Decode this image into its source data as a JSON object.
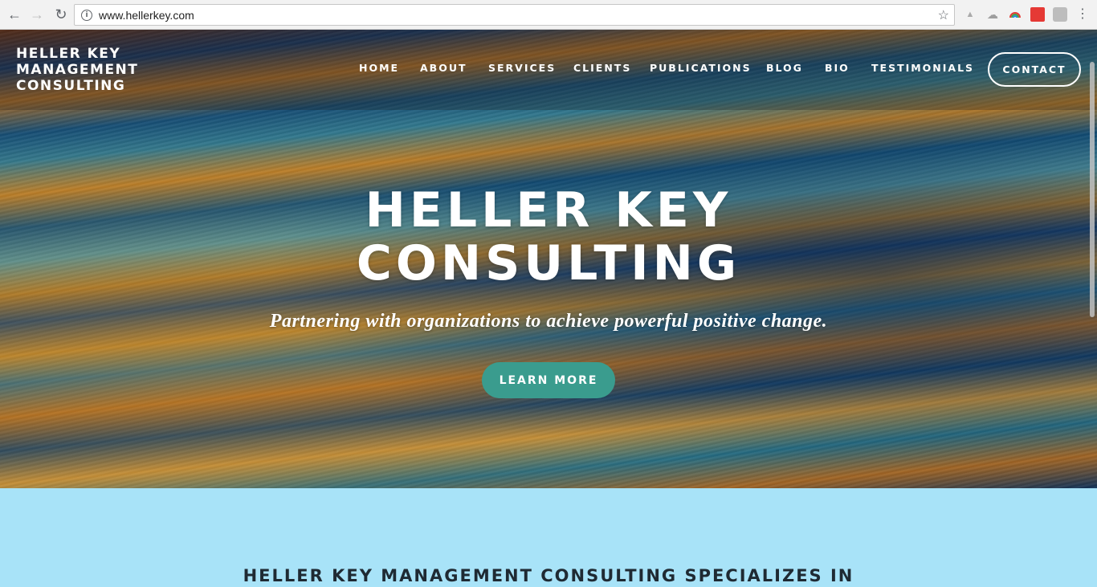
{
  "browser": {
    "url": "www.hellerkey.com",
    "back_glyph": "←",
    "forward_glyph": "→",
    "reload_glyph": "↻",
    "info_glyph": "i",
    "star_glyph": "☆",
    "menu_glyph": "⋮",
    "extensions": [
      {
        "name": "drive-upload-icon",
        "glyph": "▲"
      },
      {
        "name": "cloud-icon",
        "glyph": "☁"
      },
      {
        "name": "rainbow-extension-icon",
        "glyph": "◠"
      },
      {
        "name": "red-extension-icon",
        "glyph": "■"
      },
      {
        "name": "gray-extension-icon",
        "glyph": "▣"
      }
    ]
  },
  "site": {
    "logo_lines": [
      "HELLER KEY",
      "MANAGEMENT",
      "CONSULTING"
    ],
    "nav": [
      "HOME",
      "ABOUT",
      "SERVICES",
      "CLIENTS",
      "PUBLICATIONS",
      "BLOG",
      "BIO",
      "TESTIMONIALS"
    ],
    "contact_label": "CONTACT"
  },
  "hero": {
    "title_lines": [
      "HELLER KEY",
      "CONSULTING"
    ],
    "subtitle": "Partnering with organizations to achieve powerful positive change.",
    "cta_label": "LEARN MORE"
  },
  "section": {
    "heading": "HELLER KEY MANAGEMENT CONSULTING SPECIALIZES IN"
  },
  "colors": {
    "cta_background": "#3a9c8e",
    "section_background": "#a8e3f8"
  }
}
